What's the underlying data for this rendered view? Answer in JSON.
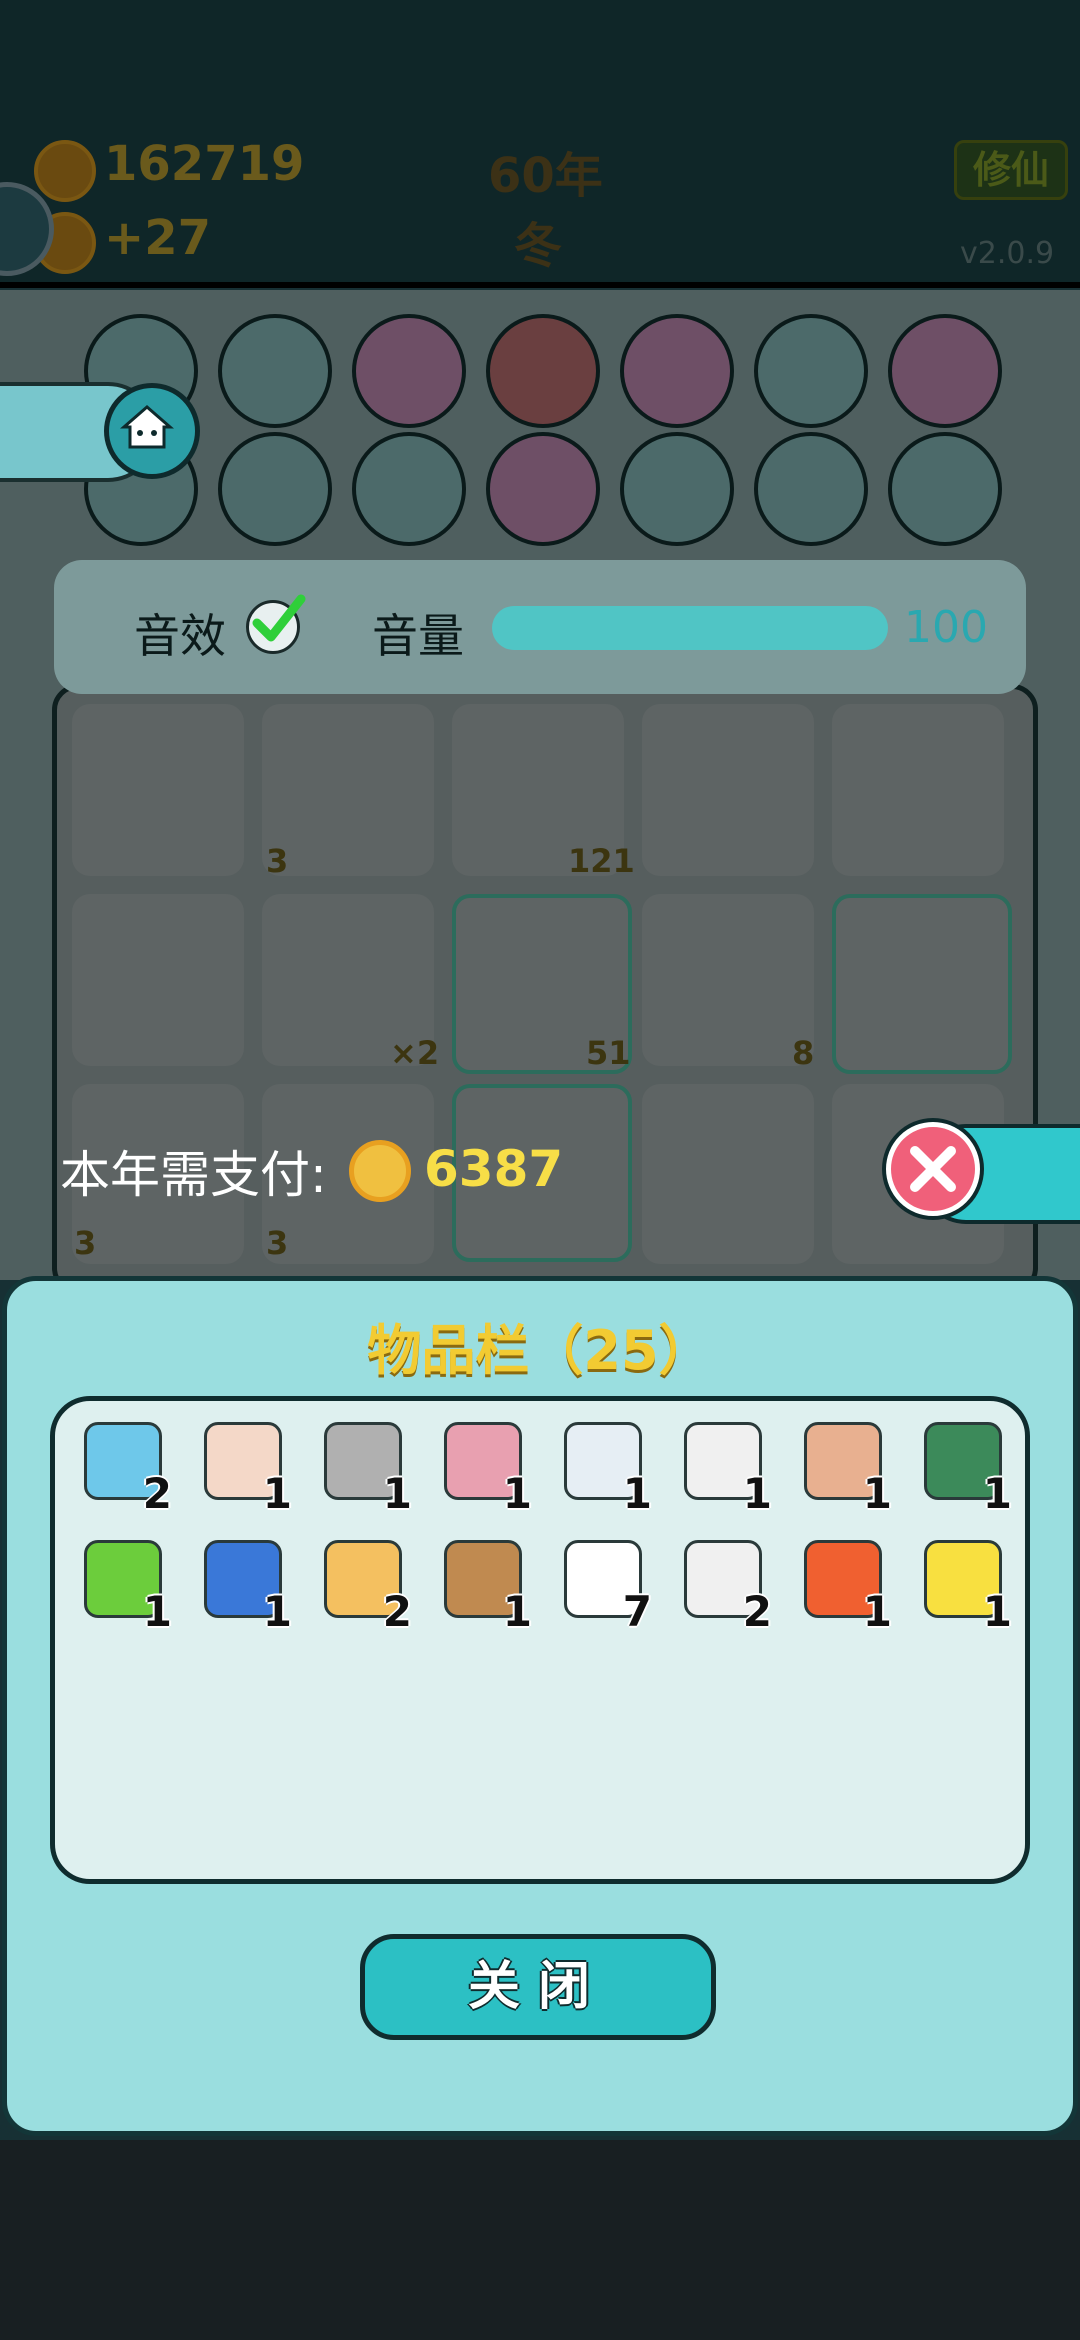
{
  "header": {
    "coins": "162719",
    "income": "+27",
    "year": "60年",
    "season": "冬",
    "cultivate_label": "修仙",
    "version": "v2.0.9"
  },
  "settings": {
    "sfx_label": "音效",
    "sfx_enabled": true,
    "volume_label": "音量",
    "volume_value": "100",
    "volume_fraction": 1.0
  },
  "board": {
    "cell_counts": [
      "3",
      "121",
      "×2",
      "51",
      "8",
      "3",
      "3"
    ]
  },
  "payment": {
    "label": "本年需支付:",
    "amount": "6387"
  },
  "inventory": {
    "title": "物品栏（25）",
    "items": [
      {
        "icon": "fridge-icon",
        "count": "2",
        "color": "#6ec8ea"
      },
      {
        "icon": "old-man-glasses-icon",
        "count": "1",
        "color": "#f4d8c8"
      },
      {
        "icon": "worker-cap-icon",
        "count": "1",
        "color": "#b0b0b0"
      },
      {
        "icon": "rabbit-house-icon",
        "count": "1",
        "color": "#e8a0b0"
      },
      {
        "icon": "husky-king-icon",
        "count": "1",
        "color": "#e6eef4"
      },
      {
        "icon": "copy-paste-icon",
        "count": "1",
        "color": "#f0f0f0"
      },
      {
        "icon": "farmer-hat-icon",
        "count": "1",
        "color": "#e8b090"
      },
      {
        "icon": "cpu-chip-icon",
        "count": "1",
        "color": "#3c8a5a"
      },
      {
        "icon": "double-rest-icon",
        "count": "1",
        "color": "#6ccd3c"
      },
      {
        "icon": "growth-chart-icon",
        "count": "1",
        "color": "#3a78d8"
      },
      {
        "icon": "chick-icon",
        "count": "2",
        "color": "#f4c060"
      },
      {
        "icon": "seed-icon",
        "count": "1",
        "color": "#c08a50"
      },
      {
        "icon": "boiled-egg-icon",
        "count": "7",
        "color": "#ffffff"
      },
      {
        "icon": "rabbit-icon",
        "count": "2",
        "color": "#f0f0f0"
      },
      {
        "icon": "carrot-icon",
        "count": "1",
        "color": "#f06030"
      },
      {
        "icon": "yellow-chick-icon",
        "count": "1",
        "color": "#f8e040"
      }
    ],
    "close_label": "关闭"
  }
}
